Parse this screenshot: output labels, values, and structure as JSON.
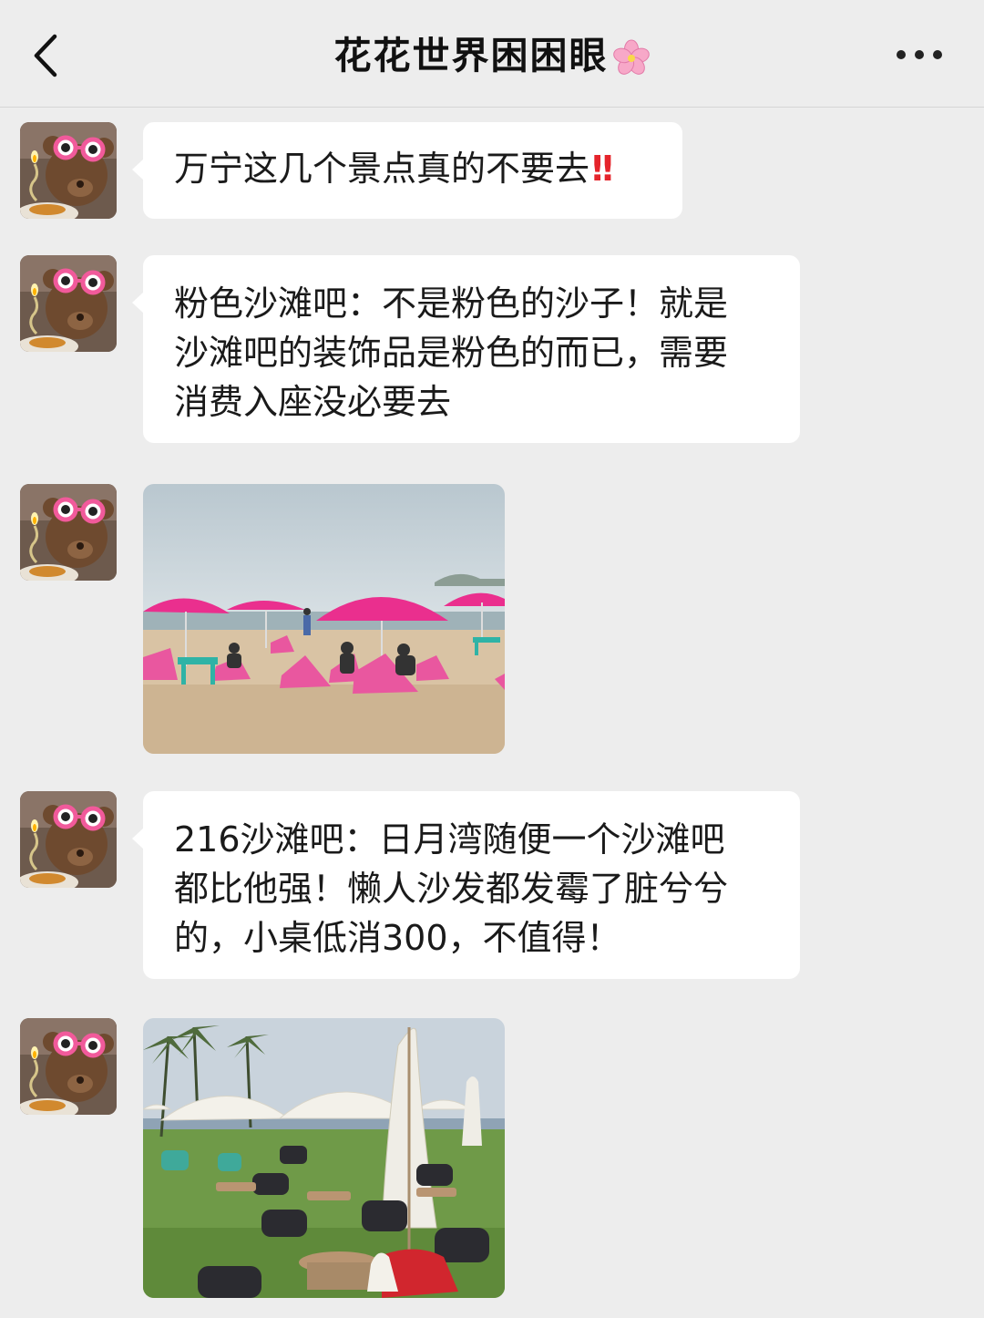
{
  "header": {
    "title": "花花世界困困眼",
    "title_icon": "cherry-blossom-icon",
    "back_icon": "chevron-left-icon",
    "more_icon": "more-dots-icon"
  },
  "messages": [
    {
      "type": "text",
      "text": "万宁这几个景点真的不要去",
      "emoji": "‼️"
    },
    {
      "type": "text",
      "text": "粉色沙滩吧：不是粉色的沙子！就是\n沙滩吧的装饰品是粉色的而已，需要\n消费入座没必要去"
    },
    {
      "type": "image",
      "subject": "pink-umbrella-beach-bar-photo"
    },
    {
      "type": "text",
      "text": "216沙滩吧：日月湾随便一个沙滩吧\n都比他强！懒人沙发都发霉了脏兮兮\n的，小桌低消300，不值得！"
    },
    {
      "type": "image",
      "subject": "white-umbrella-lawn-beach-bar-photo"
    }
  ],
  "colors": {
    "background": "#ededed",
    "bubble": "#ffffff",
    "text": "#1a1a1a",
    "accent_pink": "#e8398c",
    "emoji_red": "#e5242b"
  }
}
